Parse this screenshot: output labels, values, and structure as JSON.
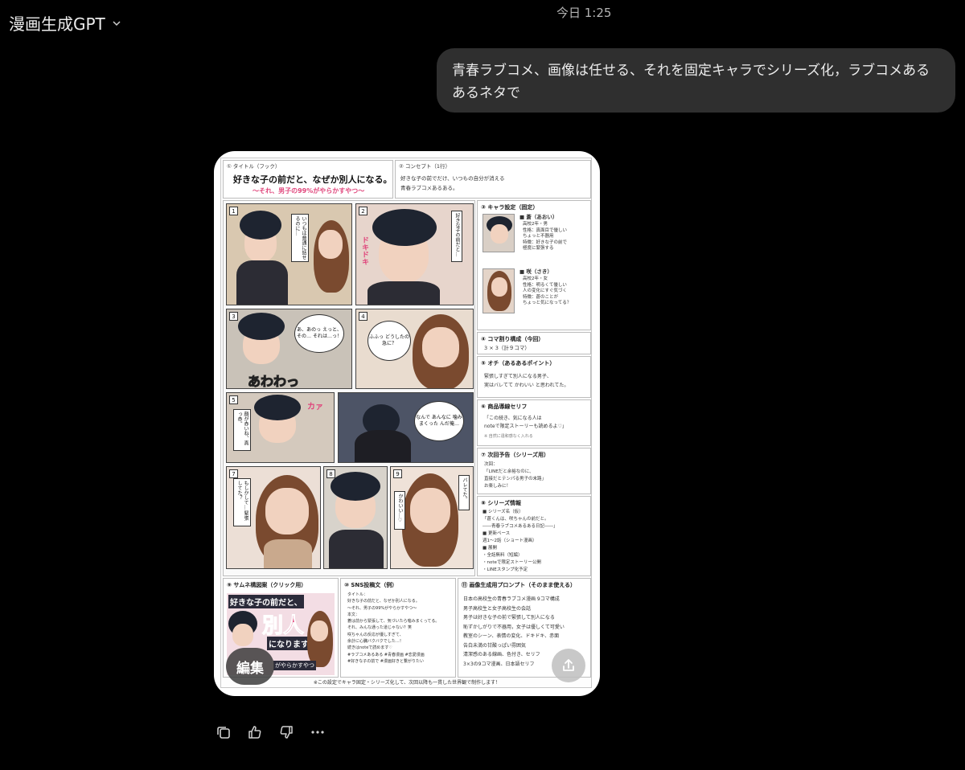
{
  "header": {
    "app_title": "漫画生成GPT",
    "timestamp": "今日 1:25"
  },
  "conversation": {
    "user_message": "青春ラブコメ、画像は任せる、それを固定キャラでシリーズ化，ラブコメあるあるネタで"
  },
  "generated_image": {
    "sections": {
      "title_label": "① タイトル（フック）",
      "title_main": "好きな子の前だと、なぜか別人になる。",
      "title_sub": "〜それ、男子の99%がやらかすやつ〜",
      "concept_label": "② コンセプト（1行）",
      "concept_line1": "好きな子の前でだけ、いつもの自分が消える",
      "concept_line2": "青春ラブコメあるある。",
      "chara_label": "③ キャラ設定（固定）",
      "chara_aoi_name": "■ 蒼（あおい）",
      "chara_aoi_lines": [
        "高校2年・男",
        "性格：真面目で優しい",
        "ちょっと不器用",
        "特徴：好きな子の前で",
        "極度に緊張する"
      ],
      "chara_saki_name": "■ 咲（さき）",
      "chara_saki_lines": [
        "高校2年・女",
        "性格：明るくて優しい",
        "人の変化にすぐ気づく",
        "特徴：蒼のことが",
        "ちょっと気になってる？"
      ],
      "koma_label": "④ コマ割り構成（今回）",
      "koma_value": "3 × 3（計９コマ）",
      "ochi_label": "⑤ オチ（あるあるポイント）",
      "ochi_line1": "緊張しすぎて別人になる男子、",
      "ochi_line2": "実はバレてて かわいい と思われてた。",
      "shohin_label": "⑥ 商品導線セリフ",
      "shohin_line1": "「この続き、気になる人は",
      "shohin_line2": "noteで限定ストーリーも読めるよ♡」",
      "shohin_note": "※ 自然に違和感なく入れる",
      "jikai_label": "⑦ 次回予告（シリーズ用）",
      "jikai_lines": [
        "次回：",
        "「LINEだと余裕なのに、",
        "直接だとテンパる男子の末路」",
        "お楽しみに！"
      ],
      "series_label": "⑧ シリーズ情報",
      "series_lines": [
        "■ シリーズ名（仮）",
        "「蒼くんは、咲ちゃんの前だと。",
        "――青春ラブコメあるある日記――」",
        "■ 更新ペース",
        "週1〜2話（ショート漫画）",
        "■ 展開",
        "・全話無料（短編）",
        "・noteで限定ストーリー公開",
        "・LINEスタンプ化予定"
      ],
      "thumb_label": "⑨ サムネ構図案（クリック用）",
      "thumb_text1": "好きな子の前だと、",
      "thumb_text2": "別人",
      "thumb_text3": "になります。",
      "thumb_text4": "がやらかすやつ",
      "sns_label": "⑩ SNS投稿文（例）",
      "sns_lines": [
        "タイトル：",
        "好きな子の前だと、なぜか別人になる。",
        "〜それ、男子の99%がやらかすやつ〜",
        "本文：",
        "蒼は前から緊張して、気づいたら噛みまくってる。",
        "それ、みんな通った道じゃない？笑",
        "咲ちゃんの反応が優しすぎて、",
        "余計に心臓バクバクでした…！",
        "続きはnoteで読めます♡",
        "#ラブコメあるある #青春漫画 #恋愛漫画",
        "#好きな子の前で #漫画好きと繋がりたい"
      ],
      "prompt_label": "⑪ 画像生成用プロンプト（そのまま使える）",
      "prompt_lines": [
        "日本の高校生の青春ラブコメ漫画 9コマ構成",
        "男子高校生と女子高校生の会話",
        "男子は好きな子の前で緊張して別人になる",
        "恥ずかしがりで不器用，女子は優しくて可愛い",
        "教室のシーン、表情の変化、ドキドキ、赤面",
        "告白未満の甘酸っぱい雰囲気",
        "清潔感のある線画、色付き、セリフ",
        "3×3の9コマ漫画、日本語セリフ"
      ],
      "footer_note": "※この設定でキャラ固定・シリーズ化して、次回以降も一貫した世界観で制作します！"
    },
    "panels": {
      "p1_bubble": "いつもは普通に話せるのに…",
      "p2_bubble": "好きな子の前だと…",
      "p2_sfx": "ドキドキ",
      "p3_bubble": "あ、あのっ えっと、その… それは…っ！",
      "p3_sfx": "あわわっ",
      "p4_bubble": "ふふっ どうしたの 急に？",
      "p5_bubble": "顔が赤いね、真っ赤。",
      "p5_sfx": "カァ",
      "p6_bubble": "なんで あんなに 噛みまくった んだ俺…",
      "p7_bubble": "もしかして… 緊張してた？",
      "p9_bubble1": "かわいい…♡",
      "p9_bubble2": "バレてた。"
    },
    "edit_label": "編集"
  },
  "icons": {
    "chevron": "chevron-down-icon",
    "share": "share-icon",
    "copy": "copy-icon",
    "like": "thumbs-up-icon",
    "dislike": "thumbs-down-icon",
    "more": "more-icon"
  },
  "colors": {
    "background": "#000000",
    "user_bubble": "#2f2f2f",
    "text": "#ececec",
    "accent_pink": "#e0457b"
  }
}
